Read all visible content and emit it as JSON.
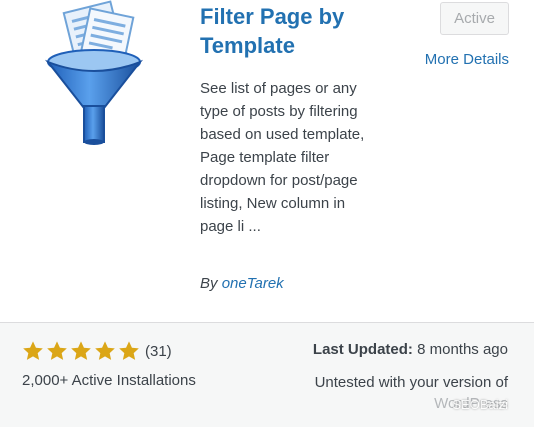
{
  "plugin": {
    "title": "Filter Page by Template",
    "status_button": "Active",
    "more_details": "More Details",
    "description": "See list of pages or any type of posts by filtering based on used template, Page template filter dropdown for post/page listing, New column in page li ...",
    "author_prefix": "By",
    "author_name": "oneTarek",
    "icon": "document-funnel-icon"
  },
  "footer": {
    "rating_stars": 5,
    "rating_count": "(31)",
    "installs": "2,000+ Active Installations",
    "last_updated_label": "Last Updated:",
    "last_updated_value": "8 months ago",
    "compat_line1": "Untested with your version of",
    "compat_line2": "WordPress",
    "watermark": "SEOBaizi"
  },
  "colors": {
    "link": "#2271b1",
    "star": "#dba617",
    "text": "#3c434a",
    "footer_bg": "#f6f7f7"
  }
}
